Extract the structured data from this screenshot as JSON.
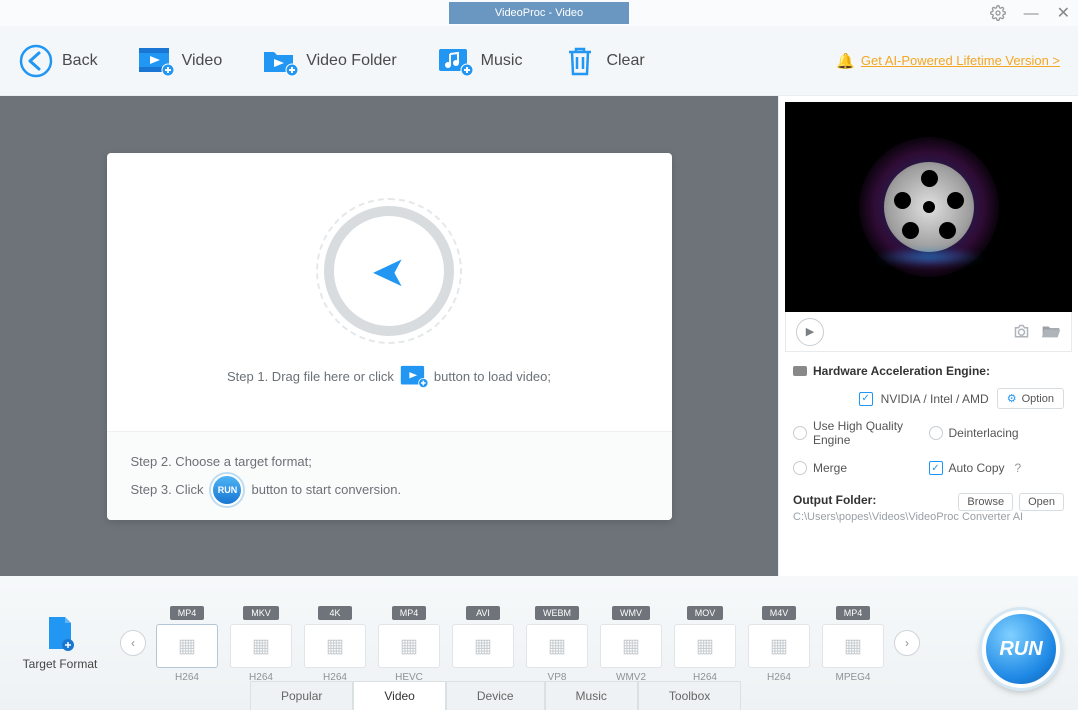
{
  "title": "VideoProc - Video",
  "toolbar": {
    "back": "Back",
    "video": "Video",
    "videoFolder": "Video Folder",
    "music": "Music",
    "clear": "Clear",
    "promo": "Get AI-Powered Lifetime Version >"
  },
  "drop": {
    "step1a": "Step 1. Drag file here or click",
    "step1b": "button to load video;",
    "step2": "Step 2. Choose a target format;",
    "step3a": "Step 3. Click",
    "step3b": "button to start conversion.",
    "miniRun": "RUN"
  },
  "sidebar": {
    "hwTitle": "Hardware Acceleration Engine:",
    "hwVendors": "NVIDIA / Intel / AMD",
    "optionBtn": "Option",
    "useHQ": "Use High Quality Engine",
    "deinterlacing": "Deinterlacing",
    "merge": "Merge",
    "autoCopy": "Auto Copy",
    "outputFolderLabel": "Output Folder:",
    "browse": "Browse",
    "open": "Open",
    "outputPath": "C:\\Users\\popes\\Videos\\VideoProc Converter AI"
  },
  "formats": {
    "targetFormat": "Target Format",
    "items": [
      {
        "badge": "MP4",
        "codec": "H264"
      },
      {
        "badge": "MKV",
        "codec": "H264"
      },
      {
        "badge": "4K",
        "codec": "H264"
      },
      {
        "badge": "MP4",
        "codec": "HEVC"
      },
      {
        "badge": "AVI",
        "codec": ""
      },
      {
        "badge": "WEBM",
        "codec": "VP8"
      },
      {
        "badge": "WMV",
        "codec": "WMV2"
      },
      {
        "badge": "MOV",
        "codec": "H264"
      },
      {
        "badge": "M4V",
        "codec": "H264"
      },
      {
        "badge": "MP4",
        "codec": "MPEG4"
      }
    ],
    "tabs": [
      "Popular",
      "Video",
      "Device",
      "Music",
      "Toolbox"
    ],
    "activeTab": 1,
    "run": "RUN"
  }
}
